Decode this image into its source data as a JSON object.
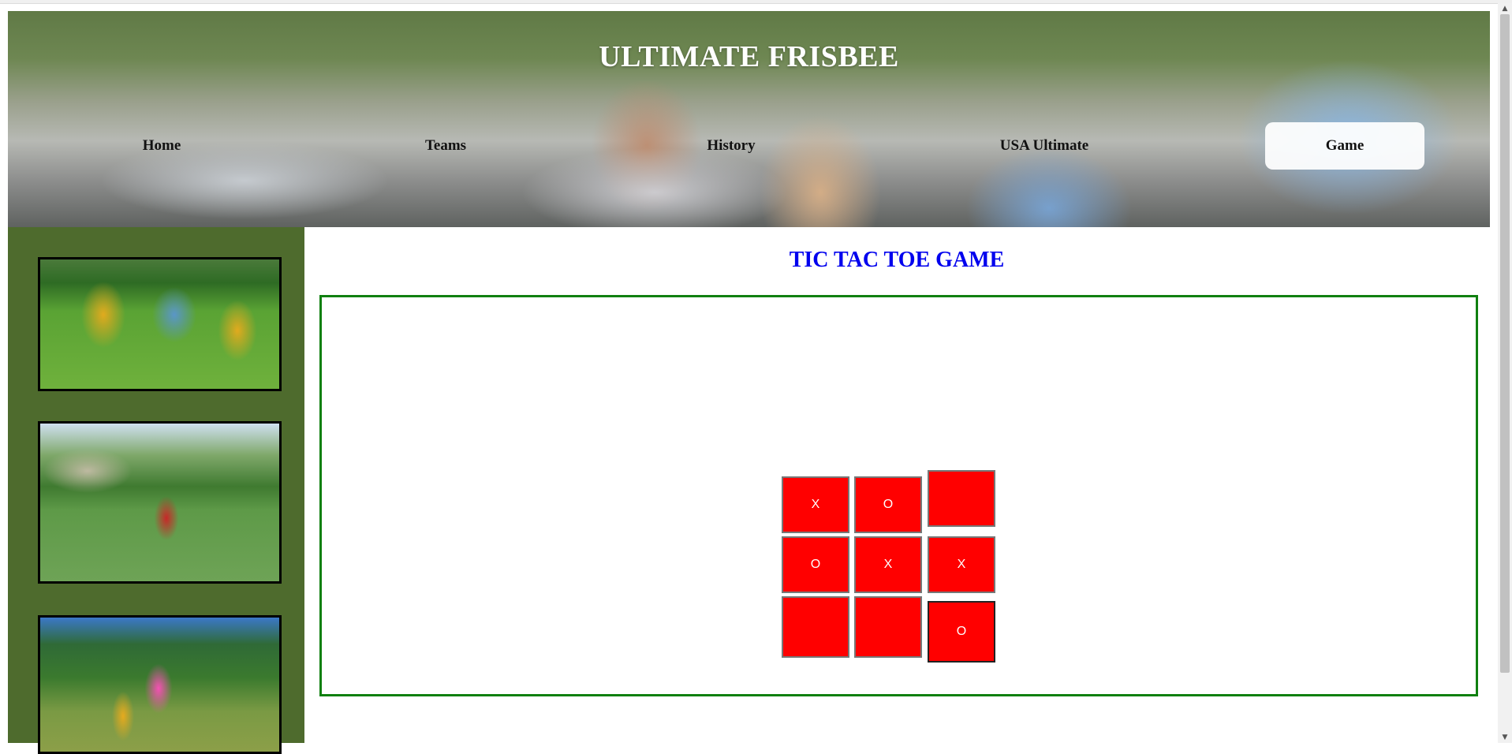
{
  "header": {
    "title": "ULTIMATE FRISBEE",
    "nav": [
      {
        "label": "Home",
        "active": false
      },
      {
        "label": "Teams",
        "active": false
      },
      {
        "label": "History",
        "active": false
      },
      {
        "label": "USA Ultimate",
        "active": false
      },
      {
        "label": "Game",
        "active": true
      }
    ]
  },
  "sidebar": {
    "images": [
      "frisbee-photo",
      "frisbee-photo",
      "frisbee-photo"
    ]
  },
  "main": {
    "title": "TIC TAC TOE GAME",
    "board": [
      "X",
      "O",
      "",
      "O",
      "X",
      "X",
      "",
      "",
      "O"
    ]
  },
  "colors": {
    "sidebar": "#4e6b2d",
    "title": "#0000ee",
    "frame_border": "#108010",
    "cell": "#ff0000"
  }
}
